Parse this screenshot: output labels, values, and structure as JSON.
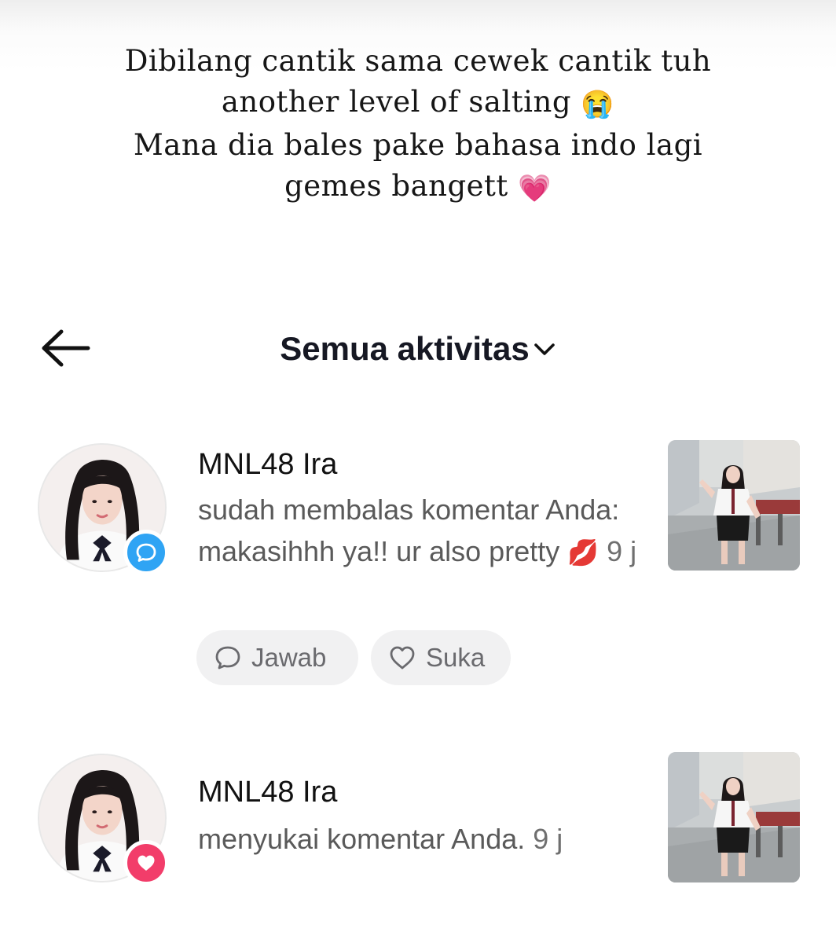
{
  "caption": {
    "lines": [
      "Dibilang cantik sama cewek cantik tuh",
      "another level of salting",
      "Mana dia bales pake bahasa indo lagi",
      "gemes bangett"
    ],
    "emoji_1": "😭",
    "emoji_2": "💗"
  },
  "header": {
    "back_icon": "arrow-left-icon",
    "title": "Semua aktivitas",
    "dropdown_icon": "chevron-down-icon"
  },
  "notifications": [
    {
      "username": "MNL48 Ira",
      "type": "reply",
      "badge_icon": "comment-bubble-icon",
      "badge_color": "#2fa4f4",
      "text": "sudah membalas komentar Anda: makasihhh ya!! ur also pretty",
      "emoji": "💋",
      "time": "9 j",
      "actions": {
        "reply_label": "Jawab",
        "reply_icon": "comment-outline-icon",
        "like_label": "Suka",
        "like_icon": "heart-outline-icon"
      }
    },
    {
      "username": "MNL48 Ira",
      "type": "like",
      "badge_icon": "heart-icon",
      "badge_color": "#f23d6a",
      "text": "menyukai komentar Anda.",
      "time": "9 j"
    }
  ],
  "colors": {
    "text_primary": "#161823",
    "text_secondary": "#5a5a5a",
    "pill_bg": "#f1f1f2"
  }
}
